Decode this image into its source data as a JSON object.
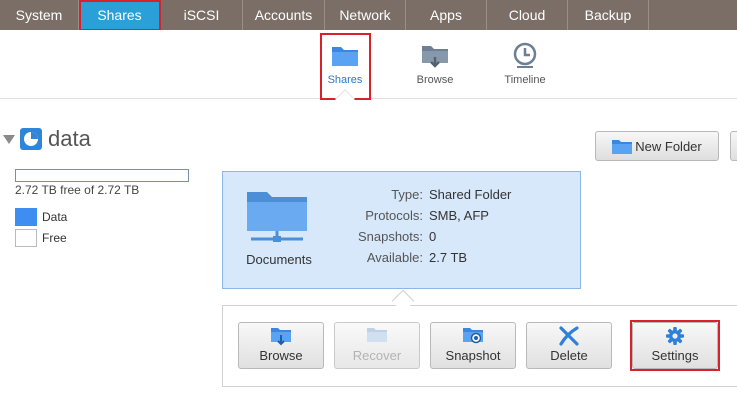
{
  "topnav": {
    "tabs": [
      {
        "label": "System"
      },
      {
        "label": "Shares"
      },
      {
        "label": "iSCSI"
      },
      {
        "label": "Accounts"
      },
      {
        "label": "Network"
      },
      {
        "label": "Apps"
      },
      {
        "label": "Cloud"
      },
      {
        "label": "Backup"
      }
    ],
    "active_color": "#2b9fd8",
    "bar_color": "#7a6e66"
  },
  "subnav": {
    "items": [
      {
        "label": "Shares",
        "icon": "folder-icon"
      },
      {
        "label": "Browse",
        "icon": "folder-browse-icon"
      },
      {
        "label": "Timeline",
        "icon": "clock-icon"
      }
    ]
  },
  "volume": {
    "name": "data",
    "usage_text": "2.72 TB free of 2.72 TB",
    "used_fraction": 0.0,
    "legend": [
      {
        "label": "Data",
        "color": "#3d8ef0"
      },
      {
        "label": "Free",
        "color": "#ffffff"
      }
    ]
  },
  "toolbar": {
    "new_folder_label": "New Folder"
  },
  "share": {
    "name": "Documents",
    "props": [
      {
        "key": "Type:",
        "value": "Shared Folder"
      },
      {
        "key": "Protocols:",
        "value": "SMB, AFP"
      },
      {
        "key": "Snapshots:",
        "value": "0"
      },
      {
        "key": "Available:",
        "value": "2.7 TB"
      }
    ]
  },
  "actions": {
    "browse": "Browse",
    "recover": "Recover",
    "snapshot": "Snapshot",
    "delete": "Delete",
    "settings": "Settings"
  },
  "highlight_color": "#d9212c"
}
